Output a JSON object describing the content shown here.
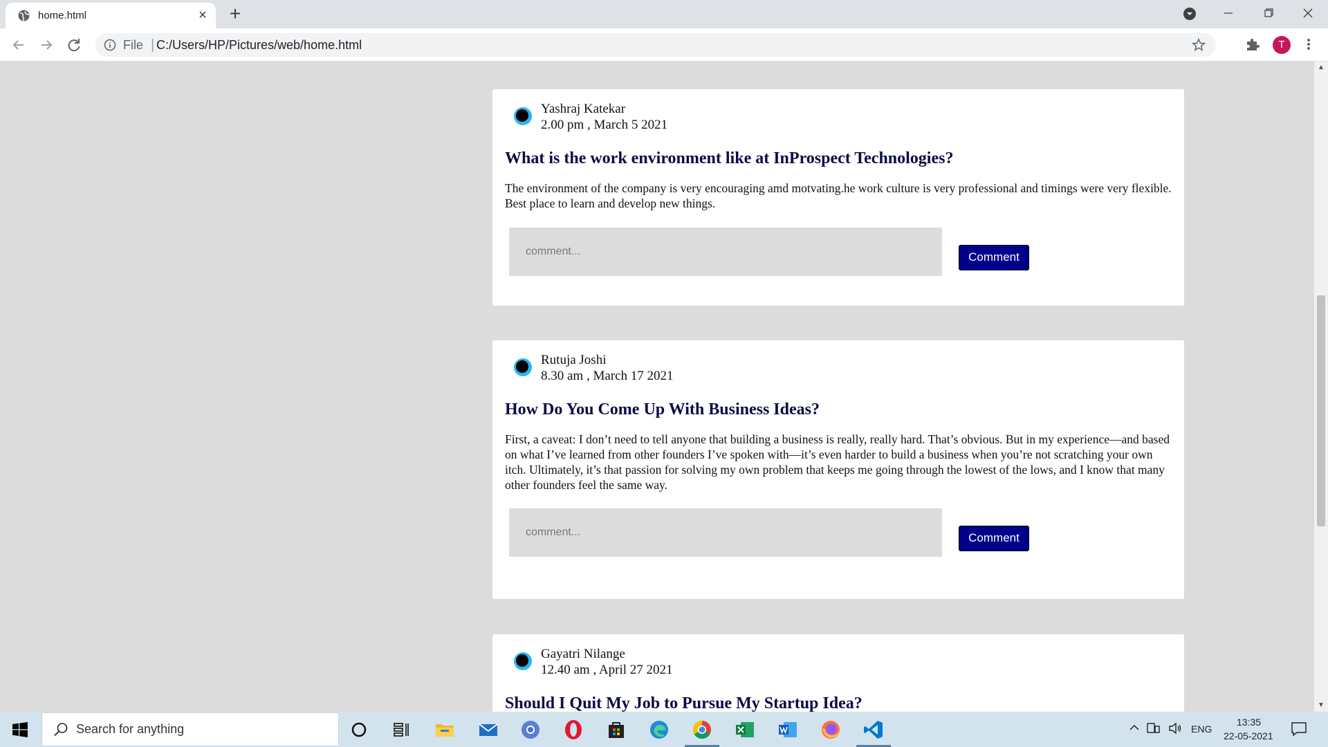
{
  "browser": {
    "tab_title": "home.html",
    "new_tab_label": "+",
    "file_label": "File",
    "url": "C:/Users/HP/Pictures/web/home.html",
    "profile_initial": "T"
  },
  "posts": [
    {
      "author": "Yashraj Katekar",
      "time": "2.00 pm , March 5 2021",
      "title": "What is the work environment like at InProspect Technologies?",
      "body": "The environment of the company is very encouraging amd motvating.he work culture is very professional and timings were very flexible. Best place to learn and develop new things.",
      "comment_placeholder": "comment...",
      "comment_button": "Comment"
    },
    {
      "author": "Rutuja Joshi",
      "time": "8.30 am , March 17 2021",
      "title": "How Do You Come Up With Business Ideas?",
      "body": "First, a caveat: I don’t need to tell anyone that building a business is really, really hard. That’s obvious. But in my experience—and based on what I’ve learned from other founders I’ve spoken with—it’s even harder to build a business when you’re not scratching your own itch. Ultimately, it’s that passion for solving my own problem that keeps me going through the lowest of the lows, and I know that many other founders feel the same way.",
      "comment_placeholder": "comment...",
      "comment_button": "Comment"
    },
    {
      "author": "Gayatri Nilange",
      "time": "12.40 am , April 27 2021",
      "title": "Should I Quit My Job to Pursue My Startup Idea?"
    }
  ],
  "taskbar": {
    "search_placeholder": "Search for anything",
    "language": "ENG",
    "time": "13:35",
    "date": "22-05-2021"
  },
  "colors": {
    "page_background": "#dcdcdc",
    "card_background": "#ffffff",
    "title_color": "#0b0b45",
    "button_color": "#00008b",
    "avatar_color": "#29b6f6"
  }
}
